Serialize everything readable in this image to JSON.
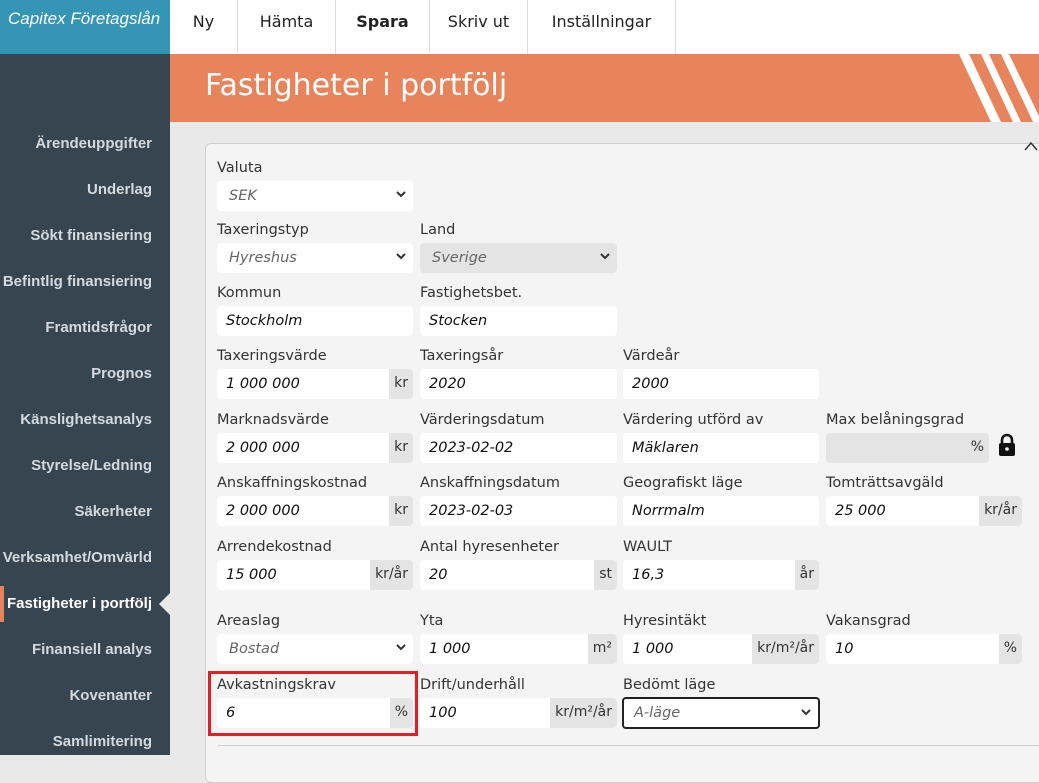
{
  "app": {
    "title": "Capitex Företagslån"
  },
  "menu": [
    "Ny",
    "Hämta",
    "Spara",
    "Skriv ut",
    "Inställningar"
  ],
  "sidebar": {
    "items": [
      "Ärendeuppgifter",
      "Underlag",
      "Sökt finansiering",
      "Befintlig finansiering",
      "Framtidsfrågor",
      "Prognos",
      "Känslighetsanalys",
      "Styrelse/Ledning",
      "Säkerheter",
      "Verksamhet/Omvärld",
      "Fastigheter i portfölj",
      "Finansiell analys",
      "Kovenanter",
      "Samlimitering"
    ],
    "active": "Fastigheter i portfölj"
  },
  "page": {
    "title": "Fastigheter i portfölj"
  },
  "form": {
    "valuta": {
      "label": "Valuta",
      "value": "SEK"
    },
    "taxeringstyp": {
      "label": "Taxeringstyp",
      "value": "Hyreshus"
    },
    "land": {
      "label": "Land",
      "value": "Sverige"
    },
    "kommun": {
      "label": "Kommun",
      "value": "Stockholm"
    },
    "fastighetsbet": {
      "label": "Fastighetsbet.",
      "value": "Stocken"
    },
    "taxeringsvarde": {
      "label": "Taxeringsvärde",
      "value": "1 000 000",
      "unit": "kr"
    },
    "taxeringsar": {
      "label": "Taxeringsår",
      "value": "2020"
    },
    "vardear": {
      "label": "Värdeår",
      "value": "2000"
    },
    "marknadsvarde": {
      "label": "Marknadsvärde",
      "value": "2 000 000",
      "unit": "kr"
    },
    "varderingsdatum": {
      "label": "Värderingsdatum",
      "value": "2023-02-02"
    },
    "vardering_utford_av": {
      "label": "Värdering utförd av",
      "value": "Mäklaren"
    },
    "max_belaningsgrad": {
      "label": "Max belåningsgrad",
      "value": "",
      "unit": "%"
    },
    "anskaffningskostnad": {
      "label": "Anskaffningskostnad",
      "value": "2 000 000",
      "unit": "kr"
    },
    "anskaffningsdatum": {
      "label": "Anskaffningsdatum",
      "value": "2023-02-03"
    },
    "geografiskt_lage": {
      "label": "Geografiskt läge",
      "value": "Norrmalm"
    },
    "tomtrattsavgald": {
      "label": "Tomträttsavgäld",
      "value": "25 000",
      "unit": "kr/år"
    },
    "arrendekostnad": {
      "label": "Arrendekostnad",
      "value": "15 000",
      "unit": "kr/år"
    },
    "antal_hyresenheter": {
      "label": "Antal hyresenheter",
      "value": "20",
      "unit": "st"
    },
    "wault": {
      "label": "WAULT",
      "value": "16,3",
      "unit": "år"
    },
    "areaslag": {
      "label": "Areaslag",
      "value": "Bostad"
    },
    "yta": {
      "label": "Yta",
      "value": "1 000",
      "unit": "m²"
    },
    "hyresintakt": {
      "label": "Hyresintäkt",
      "value": "1 000",
      "unit": "kr/m²/år"
    },
    "vakansgrad": {
      "label": "Vakansgrad",
      "value": "10",
      "unit": "%"
    },
    "avkastningskrav": {
      "label": "Avkastningskrav",
      "value": "6",
      "unit": "%"
    },
    "drift_underhall": {
      "label": "Drift/underhåll",
      "value": "100",
      "unit": "kr/m²/år"
    },
    "bedomt_lage": {
      "label": "Bedömt läge",
      "value": "A-läge"
    }
  },
  "icons": {
    "lock": "lock-icon",
    "collapse": "chevron-up-icon",
    "select": "chevron-down-icon"
  },
  "colors": {
    "brand": "#3496b4",
    "sidebar": "#36454f",
    "header": "#e8845b",
    "highlight": "#e31e24"
  }
}
